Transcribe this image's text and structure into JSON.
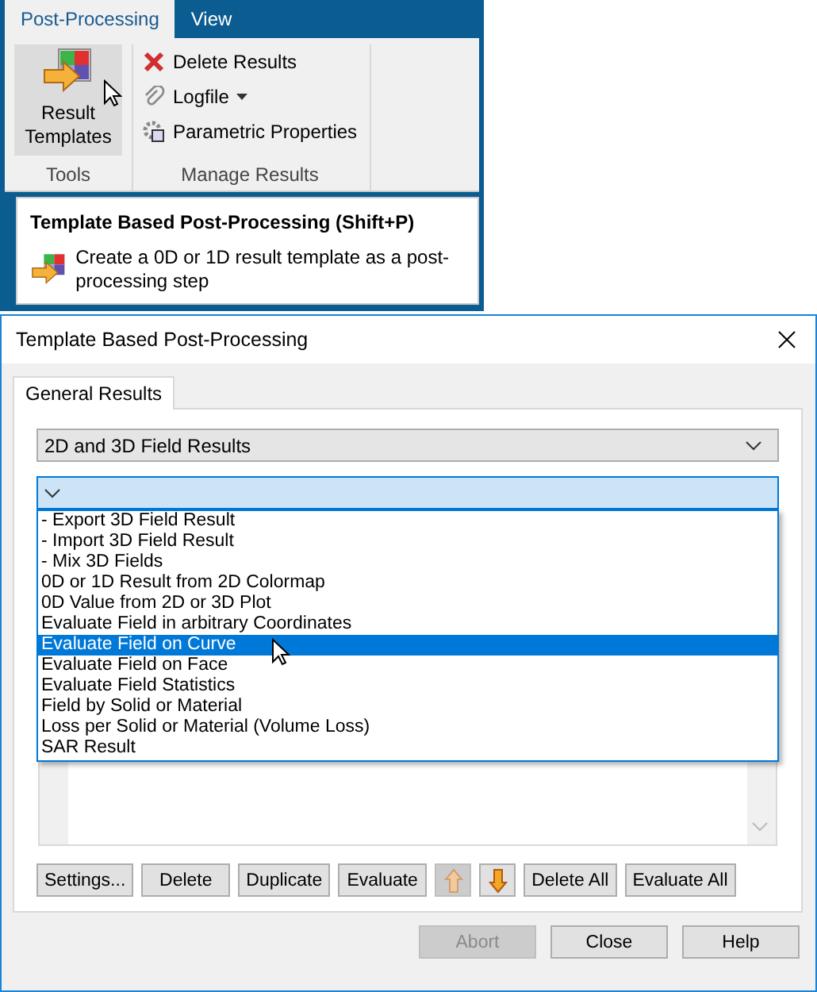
{
  "ribbon": {
    "tabs": [
      {
        "label": "Post-Processing",
        "selected": true
      },
      {
        "label": "View",
        "selected": false
      }
    ],
    "groups": [
      {
        "label": "Tools",
        "items": [
          {
            "kind": "templates",
            "label": "Result Templates",
            "hovered": true
          }
        ]
      },
      {
        "label": "Manage Results",
        "items": [
          {
            "kind": "delete",
            "label": "Delete Results",
            "dropdown": false
          },
          {
            "kind": "attach",
            "label": "Logfile",
            "dropdown": true
          },
          {
            "kind": "properties",
            "label": "Parametric Properties",
            "dropdown": false
          }
        ]
      }
    ]
  },
  "tooltip": {
    "title": "Template Based Post-Processing (Shift+P)",
    "text": "Create a 0D or 1D result template as a post-processing step"
  },
  "dialog": {
    "title": "Template Based Post-Processing",
    "tabs": [
      {
        "label": "General Results",
        "selected": true
      }
    ],
    "category_select": {
      "value": "2D and 3D Field Results"
    },
    "template_select": {
      "expanded": true,
      "options": [
        {
          "label": "- Export 3D Field Result",
          "selected": false
        },
        {
          "label": "- Import 3D Field Result",
          "selected": false
        },
        {
          "label": "- Mix 3D Fields",
          "selected": false
        },
        {
          "label": "0D or 1D Result from 2D Colormap",
          "selected": false
        },
        {
          "label": "0D Value from 2D or 3D Plot",
          "selected": false
        },
        {
          "label": "Evaluate Field in arbitrary Coordinates",
          "selected": false
        },
        {
          "label": "Evaluate Field on Curve",
          "selected": true
        },
        {
          "label": "Evaluate Field on Face",
          "selected": false
        },
        {
          "label": "Evaluate Field Statistics",
          "selected": false
        },
        {
          "label": "Field by Solid or Material",
          "selected": false
        },
        {
          "label": "Loss per Solid or Material (Volume Loss)",
          "selected": false
        },
        {
          "label": "SAR Result",
          "selected": false
        }
      ]
    },
    "list_buttons": [
      {
        "kind": "text",
        "label": "Settings...",
        "disabled": false
      },
      {
        "kind": "text",
        "label": "Delete",
        "disabled": false
      },
      {
        "kind": "text",
        "label": "Duplicate",
        "disabled": false
      },
      {
        "kind": "text",
        "label": "Evaluate",
        "disabled": false
      },
      {
        "kind": "up",
        "disabled": true
      },
      {
        "kind": "down",
        "disabled": false
      },
      {
        "kind": "text",
        "label": "Delete All",
        "disabled": false
      },
      {
        "kind": "text",
        "label": "Evaluate All",
        "disabled": false
      }
    ],
    "footer_buttons": [
      {
        "label": "Abort",
        "disabled": true
      },
      {
        "label": "Close",
        "disabled": false
      },
      {
        "label": "Help",
        "disabled": false
      }
    ]
  }
}
